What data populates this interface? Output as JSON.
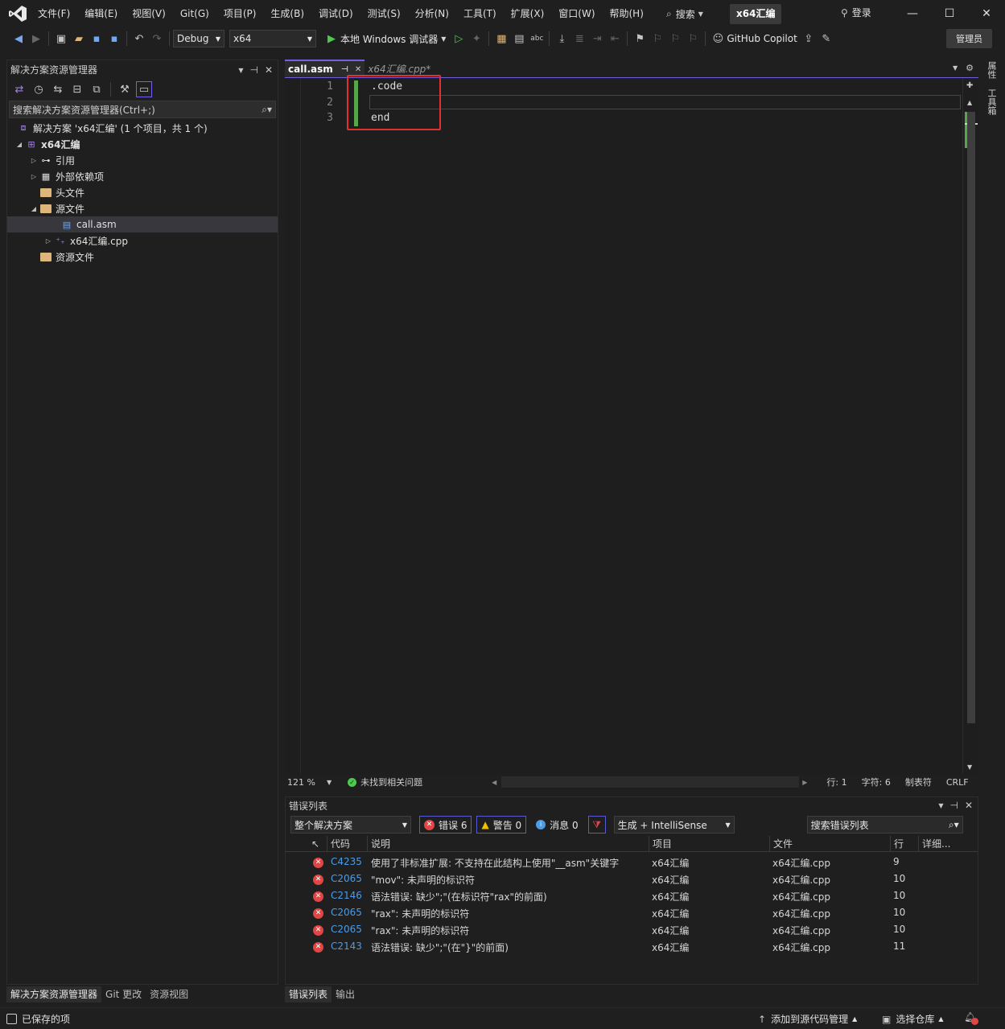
{
  "menubar": {
    "items": [
      "文件(F)",
      "编辑(E)",
      "视图(V)",
      "Git(G)",
      "项目(P)",
      "生成(B)",
      "调试(D)",
      "测试(S)",
      "分析(N)",
      "工具(T)",
      "扩展(X)",
      "窗口(W)",
      "帮助(H)"
    ],
    "search_label": "搜索",
    "project_name": "x64汇编",
    "login_label": "登录"
  },
  "toolbar": {
    "config": "Debug",
    "platform": "x64",
    "run_label": "本地 Windows 调试器",
    "copilot_label": "GitHub Copilot",
    "admin_label": "管理员"
  },
  "solution_explorer": {
    "title": "解决方案资源管理器",
    "search_placeholder": "搜索解决方案资源管理器(Ctrl+;)",
    "solution_label": "解决方案 'x64汇编' (1 个项目，共 1 个)",
    "project_label": "x64汇编",
    "nodes": [
      "引用",
      "外部依赖项",
      "头文件",
      "源文件",
      "call.asm",
      "x64汇编.cpp",
      "资源文件"
    ],
    "bottom_tabs": [
      "解决方案资源管理器",
      "Git 更改",
      "资源视图"
    ]
  },
  "editor": {
    "tabs": [
      "call.asm",
      "x64汇编.cpp*"
    ],
    "line_numbers": [
      "1",
      "2",
      "3"
    ],
    "lines": [
      ".code",
      "",
      "end"
    ],
    "zoom": "121 %",
    "issues": "未找到相关问题",
    "line_col": "行: 1",
    "char_col": "字符: 6",
    "indent": "制表符",
    "eol": "CRLF"
  },
  "right_tabs": [
    "属性",
    "工具箱"
  ],
  "error_list": {
    "title": "错误列表",
    "scope": "整个解决方案",
    "errors_label": "错误 6",
    "warnings_label": "警告 0",
    "messages_label": "消息 0",
    "build_filter": "生成 + IntelliSense",
    "search_placeholder": "搜索错误列表",
    "columns": [
      "代码",
      "说明",
      "项目",
      "文件",
      "行",
      "详细..."
    ],
    "rows": [
      {
        "code": "C4235",
        "desc": "使用了非标准扩展: 不支持在此结构上使用\"__asm\"关键字",
        "project": "x64汇编",
        "file": "x64汇编.cpp",
        "line": "9"
      },
      {
        "code": "C2065",
        "desc": "\"mov\": 未声明的标识符",
        "project": "x64汇编",
        "file": "x64汇编.cpp",
        "line": "10"
      },
      {
        "code": "C2146",
        "desc": "语法错误: 缺少\";\"(在标识符\"rax\"的前面)",
        "project": "x64汇编",
        "file": "x64汇编.cpp",
        "line": "10"
      },
      {
        "code": "C2065",
        "desc": "\"rax\": 未声明的标识符",
        "project": "x64汇编",
        "file": "x64汇编.cpp",
        "line": "10"
      },
      {
        "code": "C2065",
        "desc": "\"rax\": 未声明的标识符",
        "project": "x64汇编",
        "file": "x64汇编.cpp",
        "line": "10"
      },
      {
        "code": "C2143",
        "desc": "语法错误: 缺少\";\"(在\"}\"的前面)",
        "project": "x64汇编",
        "file": "x64汇编.cpp",
        "line": "11"
      }
    ],
    "bottom_tabs": [
      "错误列表",
      "输出"
    ]
  },
  "statusbar": {
    "saved": "已保存的项",
    "add_source_control": "添加到源代码管理",
    "select_repo": "选择仓库"
  }
}
